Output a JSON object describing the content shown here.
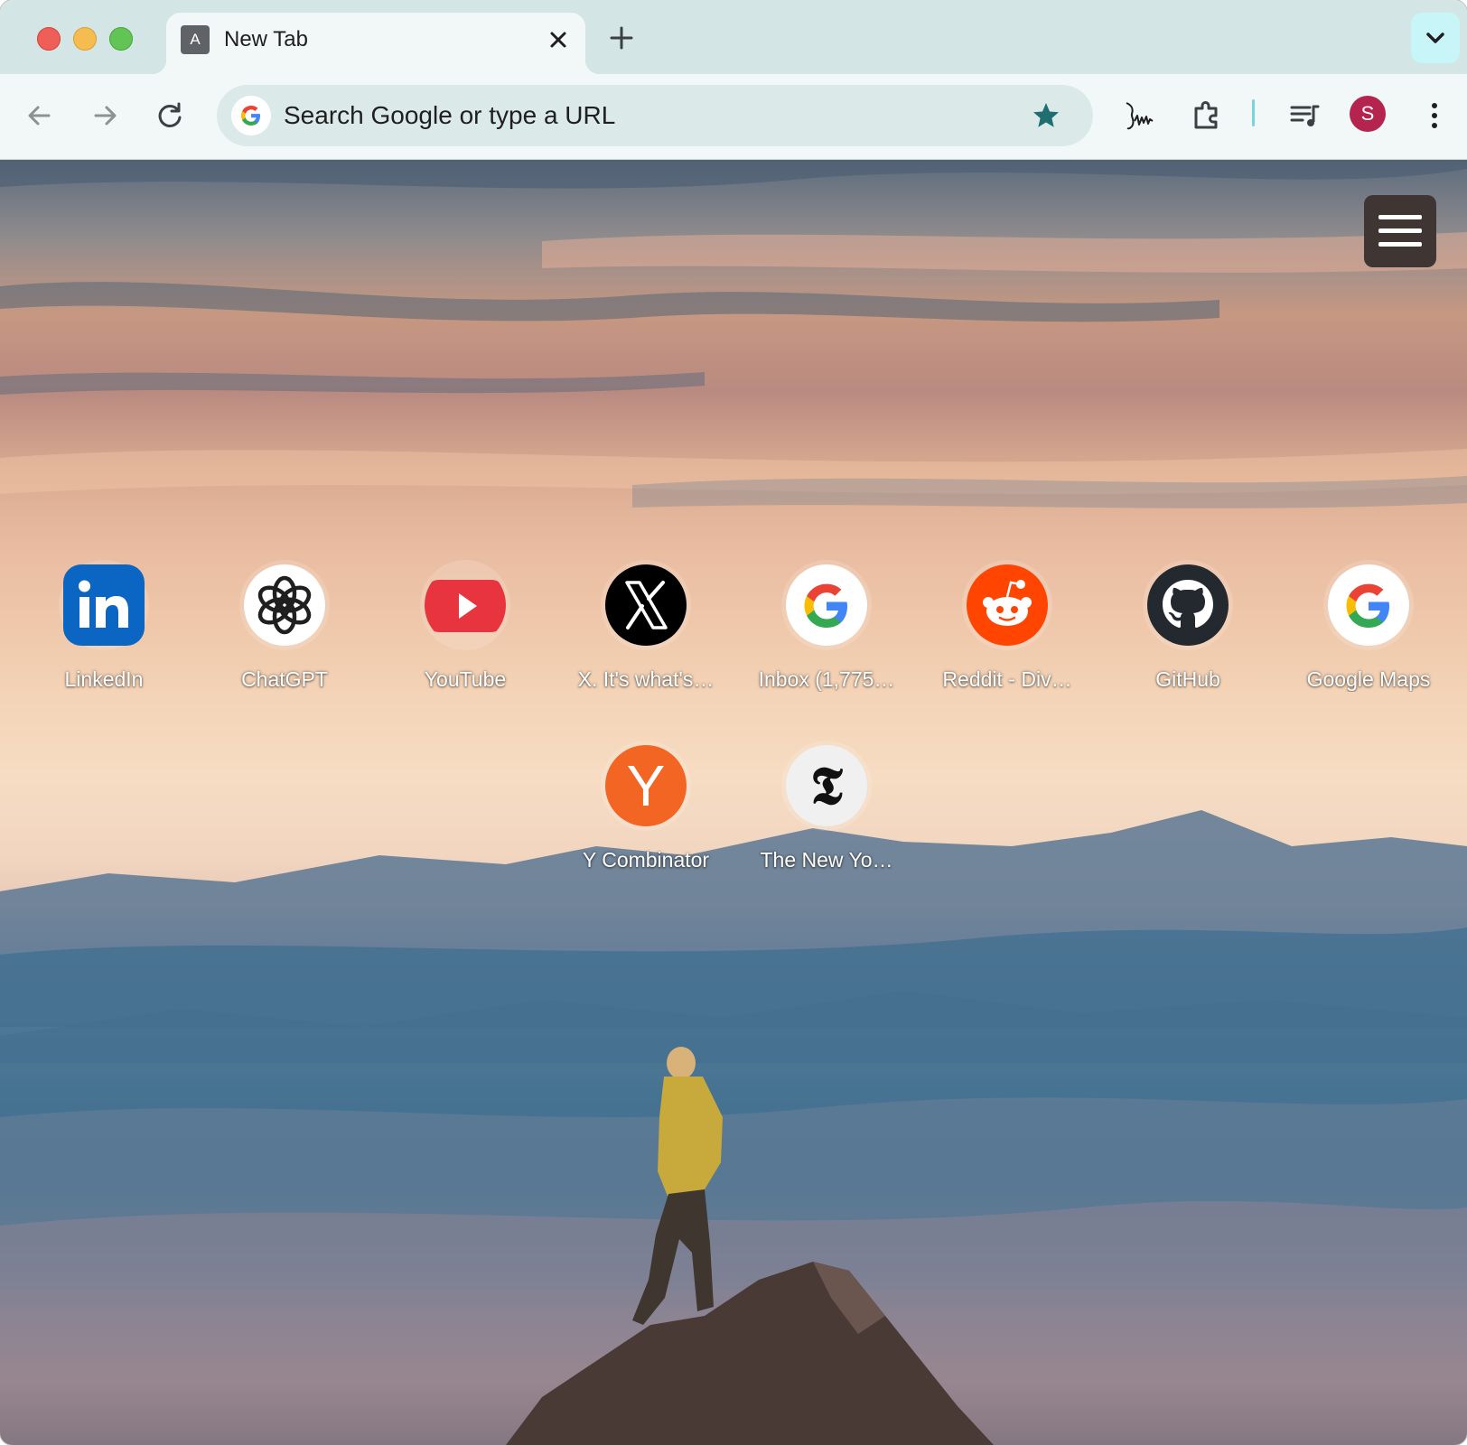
{
  "tab": {
    "favicon_letter": "A",
    "title": "New Tab"
  },
  "omnibox": {
    "placeholder": "Search Google or type a URL"
  },
  "profile": {
    "initial": "S",
    "color": "#b5244f"
  },
  "shortcuts": [
    {
      "label": "LinkedIn",
      "icon": "linkedin-icon"
    },
    {
      "label": "ChatGPT",
      "icon": "chatgpt-icon"
    },
    {
      "label": "YouTube",
      "icon": "youtube-icon"
    },
    {
      "label": "X. It's what's…",
      "icon": "x-icon"
    },
    {
      "label": "Inbox (1,775…",
      "icon": "google-icon"
    },
    {
      "label": "Reddit - Div…",
      "icon": "reddit-icon"
    },
    {
      "label": "GitHub",
      "icon": "github-icon"
    },
    {
      "label": "Google Maps",
      "icon": "google-icon"
    },
    {
      "label": "Y Combinator",
      "icon": "ycombinator-icon",
      "letter": "Y"
    },
    {
      "label": "The New Yo…",
      "icon": "nytimes-icon",
      "letter": "𝕿"
    }
  ],
  "colors": {
    "tabstrip": "#d4e5e5",
    "toolbar": "#f2f8f7",
    "omnibox": "#dce9e9",
    "accent": "#1f6f72"
  }
}
